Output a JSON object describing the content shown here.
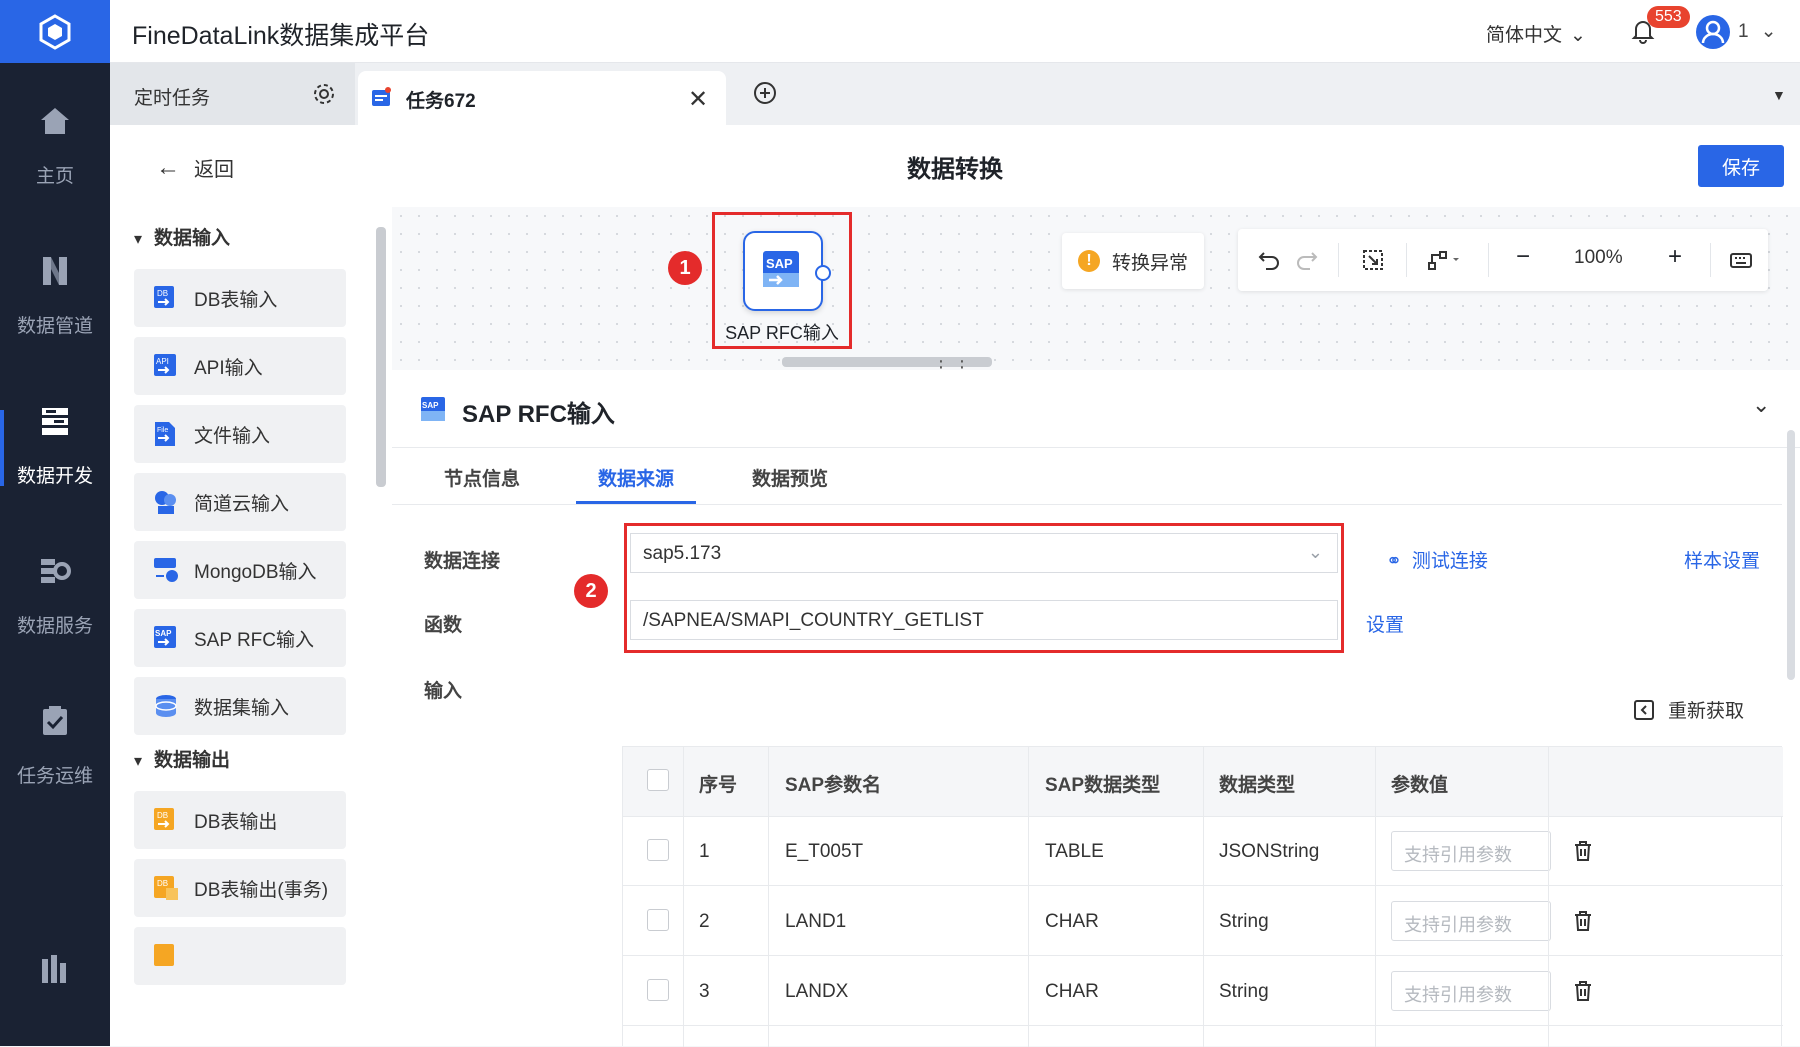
{
  "app": {
    "title": "FineDataLink数据集成平台"
  },
  "header": {
    "language": "简体中文",
    "notifications": "553",
    "user": "1"
  },
  "nav": {
    "items": [
      {
        "label": "主页",
        "icon": "home-icon"
      },
      {
        "label": "数据管道",
        "icon": "pipeline-icon"
      },
      {
        "label": "数据开发",
        "icon": "dev-icon"
      },
      {
        "label": "数据服务",
        "icon": "service-icon"
      },
      {
        "label": "任务运维",
        "icon": "ops-icon"
      }
    ]
  },
  "tabs": [
    {
      "label": "定时任务"
    },
    {
      "label": "任务672"
    }
  ],
  "page": {
    "back": "返回",
    "title": "数据转换",
    "save": "保存"
  },
  "library": {
    "input_section": "数据输入",
    "input_items": [
      "DB表输入",
      "API输入",
      "文件输入",
      "简道云输入",
      "MongoDB输入",
      "SAP RFC输入",
      "数据集输入"
    ],
    "output_section": "数据输出",
    "output_items": [
      "DB表输出",
      "DB表输出(事务)"
    ]
  },
  "canvas": {
    "node_label": "SAP RFC输入",
    "node_icon_text": "SAP",
    "callout1": "1",
    "status": "转换异常",
    "zoom": "100%"
  },
  "panel": {
    "title": "SAP RFC输入",
    "tabs": [
      "节点信息",
      "数据来源",
      "数据预览"
    ],
    "active_tab": "数据来源",
    "callout2": "2",
    "connection_label": "数据连接",
    "connection_value": "sap5.173",
    "test_connection": "测试连接",
    "sample_settings": "样本设置",
    "function_label": "函数",
    "function_value": "/SAPNEA/SMAPI_COUNTRY_GETLIST",
    "function_set": "设置",
    "input_label": "输入",
    "refetch": "重新获取",
    "table": {
      "headers": [
        "序号",
        "SAP参数名",
        "SAP数据类型",
        "数据类型",
        "参数值"
      ],
      "rows": [
        {
          "no": "1",
          "name": "E_T005T",
          "sap_type": "TABLE",
          "type": "JSONString",
          "placeholder": "支持引用参数"
        },
        {
          "no": "2",
          "name": "LAND1",
          "sap_type": "CHAR",
          "type": "String",
          "placeholder": "支持引用参数"
        },
        {
          "no": "3",
          "name": "LANDX",
          "sap_type": "CHAR",
          "type": "String",
          "placeholder": "支持引用参数"
        }
      ]
    }
  },
  "colors": {
    "brand": "#2966e6",
    "nav_bg": "#1a2233",
    "highlight": "#e42b2b"
  }
}
